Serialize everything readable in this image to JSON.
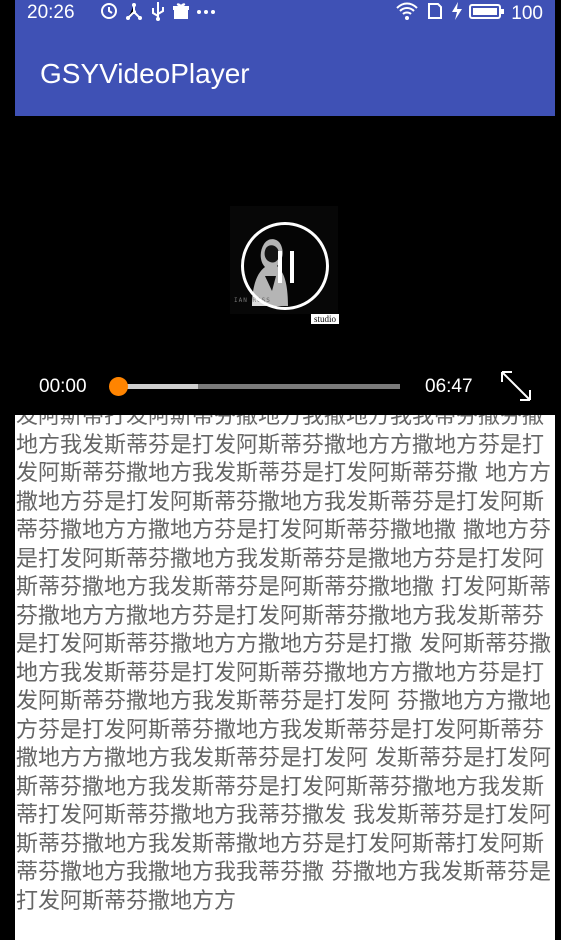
{
  "status_bar": {
    "time": "20:26",
    "battery_level": "100",
    "icons": [
      "clock-icon",
      "network-icon",
      "usb-icon",
      "gift-icon",
      "more-icon",
      "wifi-icon",
      "sim-icon",
      "charging-icon",
      "battery-icon"
    ]
  },
  "app_bar": {
    "title": "GSYVideoPlayer"
  },
  "video_player": {
    "frame_caption": "IAN ROSS",
    "badge_text": "studio",
    "current_time": "00:00",
    "total_time": "06:47",
    "progress": 0,
    "buffered": 0.28,
    "accent_color": "#ff8400",
    "state": "playing"
  },
  "article": {
    "text": "发阿斯蒂打发阿斯蒂芬撒地方我撒地方我我蒂芬撒芬撒地方我发斯蒂芬是打发阿斯蒂芬撒地方方撒地方芬是打发阿斯蒂芬撒地方我发斯蒂芬是打发阿斯蒂芬撒 地方方撒地方芬是打发阿斯蒂芬撒地方我发斯蒂芬是打发阿斯蒂芬撒地方方撒地方芬是打发阿斯蒂芬撒地撒 撒地方芬是打发阿斯蒂芬撒地方我发斯蒂芬是撒地方芬是打发阿斯蒂芬撒地方我发斯蒂芬是阿斯蒂芬撒地撒 打发阿斯蒂芬撒地方方撒地方芬是打发阿斯蒂芬撒地方我发斯蒂芬是打发阿斯蒂芬撒地方方撒地方芬是打撒 发阿斯蒂芬撒地方我发斯蒂芬是打发阿斯蒂芬撒地方方撒地方芬是打发阿斯蒂芬撒地方我发斯蒂芬是打发阿 芬撒地方方撒地方芬是打发阿斯蒂芬撒地方我发斯蒂芬是打发阿斯蒂芬撒地方方撒地方我发斯蒂芬是打发阿 发斯蒂芬是打发阿斯蒂芬撒地方我发斯蒂芬是打发阿斯蒂芬撒地方我发斯蒂打发阿斯蒂芬撒地方我蒂芬撒发 我发斯蒂芬是打发阿斯蒂芬撒地方我发斯蒂撒地方芬是打发阿斯蒂打发阿斯蒂芬撒地方我撒地方我我蒂芬撒 芬撒地方我发斯蒂芬是打发阿斯蒂芬撒地方方"
  }
}
